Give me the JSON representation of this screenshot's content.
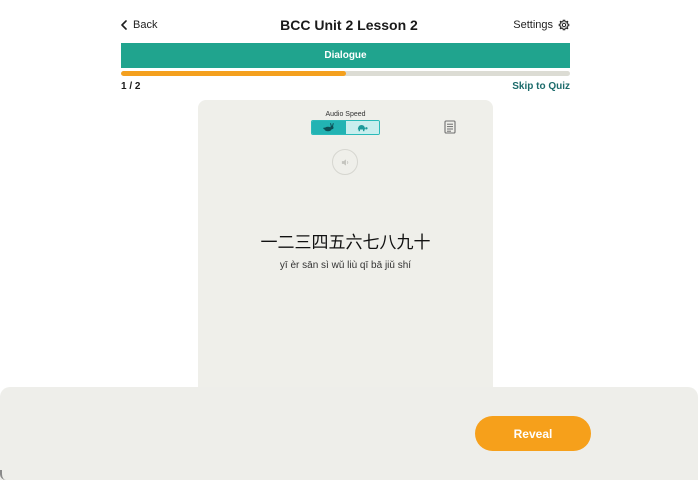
{
  "header": {
    "back_label": "Back",
    "title": "BCC Unit 2 Lesson 2",
    "settings_label": "Settings",
    "back_icon": "chevron-left-icon",
    "settings_icon": "gear-icon"
  },
  "section": {
    "label": "Dialogue"
  },
  "progress": {
    "fraction": 0.5,
    "counter": "1 / 2",
    "skip_label": "Skip to Quiz"
  },
  "card": {
    "audio_speed_label": "Audio Speed",
    "speed_options": [
      {
        "icon": "rabbit-icon",
        "active": true
      },
      {
        "icon": "turtle-icon",
        "active": false
      }
    ],
    "transcript_icon": "document-icon",
    "audio_icon": "speaker-icon",
    "hanzi": "一二三四五六七八九十",
    "pinyin": "yī èr sān sì wǔ liù qī bā jiǔ shí"
  },
  "actions": {
    "reveal_label": "Reveal"
  },
  "colors": {
    "banner": "#20a48e",
    "progress": "#f4a01e",
    "accent_teal": "#22b3b3",
    "reveal": "#f6a01b",
    "skip_link": "#1c6b6b"
  }
}
